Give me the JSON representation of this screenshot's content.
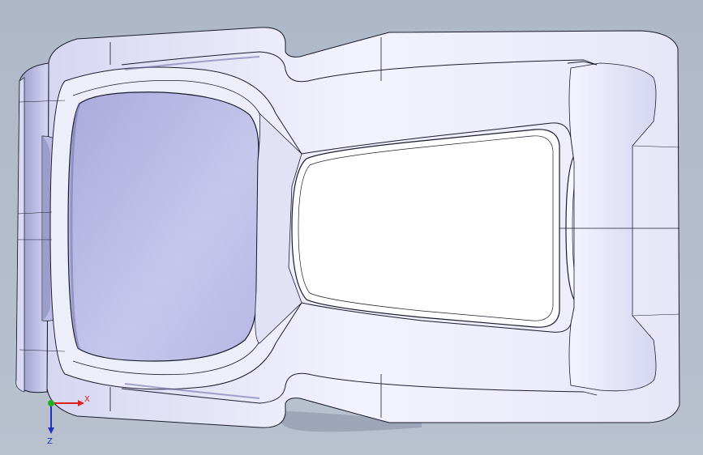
{
  "viewport": {
    "background": "#b3bccb",
    "model_color": "#e9e9fb",
    "model_shadow": "#9ea0c8",
    "edge_color": "#1b1b2e"
  },
  "triad": {
    "x_label": "X",
    "z_label": "Z",
    "x_color": "#e02020",
    "y_color": "#20b020",
    "z_color": "#2030c0"
  }
}
